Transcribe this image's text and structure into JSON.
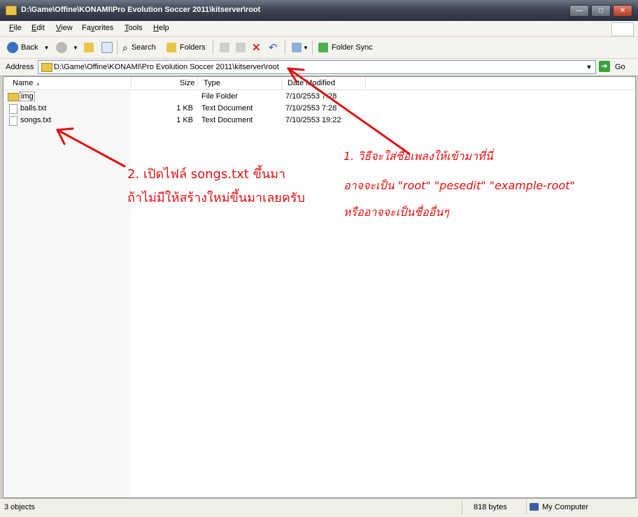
{
  "window": {
    "title": "D:\\Game\\Offine\\KONAMI\\Pro Evolution Soccer 2011\\kitserver\\root",
    "buttons": {
      "minimize": "—",
      "maximize": "□",
      "close": "✕"
    }
  },
  "menu": {
    "file": "F",
    "file_rest": "ile",
    "edit": "E",
    "edit_rest": "dit",
    "view": "V",
    "view_rest": "iew",
    "favorites": "Fa",
    "favorites_u": "v",
    "favorites_rest": "orites",
    "tools": "T",
    "tools_rest": "ools",
    "help": "H",
    "help_rest": "elp"
  },
  "toolbar": {
    "back": "Back",
    "search": "Search",
    "folders": "Folders",
    "folder_sync": "Folder Sync"
  },
  "address": {
    "label": "Address",
    "path": "D:\\Game\\Offine\\KONAMI\\Pro Evolution Soccer 2011\\kitserver\\root",
    "go": "Go"
  },
  "columns": {
    "name": "Name",
    "size": "Size",
    "type": "Type",
    "date": "Date Modified"
  },
  "files": [
    {
      "name": "img",
      "size": "",
      "type": "File Folder",
      "date": "7/10/2553 7:28",
      "kind": "folder"
    },
    {
      "name": "balls.txt",
      "size": "1 KB",
      "type": "Text Document",
      "date": "7/10/2553 7:28",
      "kind": "file"
    },
    {
      "name": "songs.txt",
      "size": "1 KB",
      "type": "Text Document",
      "date": "7/10/2553 19:22",
      "kind": "file"
    }
  ],
  "annotations": {
    "left_line1": "2. เปิดไฟล์ songs.txt ขึ้นมา",
    "left_line2": "ถ้าไม่มีให้สร้างใหม่ขึ้นมาเลยครับ",
    "right_line1": "1. วิธีจะใส่ชื่อเพลงให้เข้ามาที่นี่",
    "right_line2": "อาจจะเป็น \"root\" \"pesedit\" \"example-root\"",
    "right_line3": "หรืออาจจะเป็นชื่ออื่นๆ"
  },
  "status": {
    "objects": "3 objects",
    "size": "818 bytes",
    "location": "My Computer"
  },
  "colors": {
    "annotation": "#e01010",
    "title_bar": "#3e4653"
  }
}
